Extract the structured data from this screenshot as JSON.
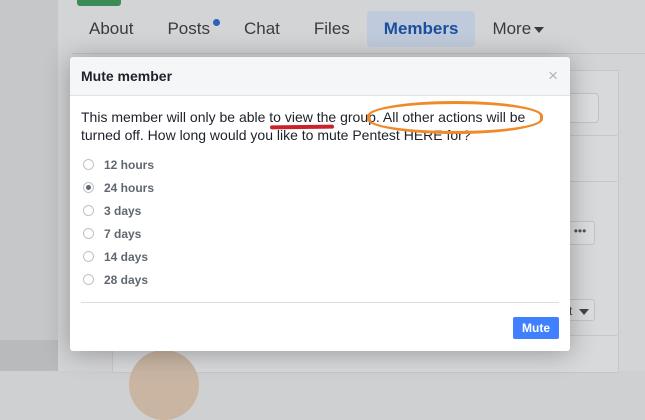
{
  "nav": {
    "tabs": [
      {
        "label": "About"
      },
      {
        "label": "Posts",
        "has_notification": true
      },
      {
        "label": "Chat"
      },
      {
        "label": "Files"
      },
      {
        "label": "Members",
        "active": true
      },
      {
        "label": "More"
      }
    ]
  },
  "background": {
    "more_button": "•••",
    "sort_button": "t"
  },
  "modal": {
    "title": "Mute member",
    "close_label": "×",
    "body_text": "This member will only be able to view the group. All other actions will be turned off. How long would you like to mute Pentest HERE for?",
    "options": [
      {
        "label": "12 hours",
        "selected": false
      },
      {
        "label": "24 hours",
        "selected": true
      },
      {
        "label": "3 days",
        "selected": false
      },
      {
        "label": "7 days",
        "selected": false
      },
      {
        "label": "14 days",
        "selected": false
      },
      {
        "label": "28 days",
        "selected": false
      }
    ],
    "mute_button": "Mute"
  },
  "annotations": {
    "underline_color": "#c8232c",
    "oval_color": "#ef8a2a"
  },
  "colors": {
    "primary": "#4080ff",
    "active_tab_text": "#1b4f9c",
    "notification_dot": "#2a62b8"
  }
}
